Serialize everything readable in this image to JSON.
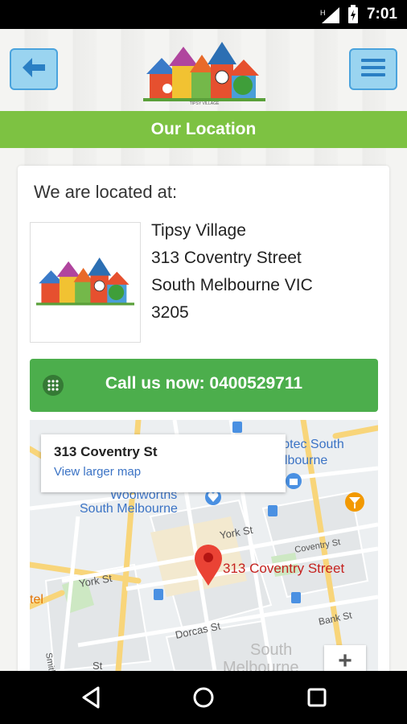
{
  "status_bar": {
    "time": "7:01"
  },
  "header": {
    "back_icon": "arrow-left-icon",
    "menu_icon": "hamburger-menu-icon",
    "logo_icon": "tipsy-village-logo"
  },
  "title_bar": {
    "title": "Our Location"
  },
  "location": {
    "intro": "We are located at:",
    "address_lines": [
      "Tipsy Village",
      "313 Coventry Street",
      "South Melbourne VIC",
      "3205"
    ]
  },
  "call_button": {
    "label": "Call us now: 0400529711",
    "icon": "phone-dialpad-icon"
  },
  "map": {
    "info_title": "313 Coventry St",
    "info_link": "View larger map",
    "pin_label": "313 Coventry Street",
    "places": {
      "woolworths": "Woolworths",
      "south_melbourne": "South Melbourne",
      "corptec": "orptec South",
      "corptec2": "elbourne",
      "york_st_1": "York St",
      "york_st_2": "York St",
      "coventry_st": "Coventry St",
      "dorcas_st": "Dorcas St",
      "bank_st": "Bank St",
      "smith_st": "Smith St",
      "tel": "tel",
      "south_bottom": "South",
      "melbourne_bottom": "Melbourne",
      "st_bottom": "St"
    },
    "zoom_label": "+",
    "colors": {
      "pin": "#ea4335",
      "pin_text": "#c5221f",
      "road_major": "#f8d57a",
      "link": "#3b73c5"
    }
  },
  "nav_bar": {
    "back_icon": "nav-back-icon",
    "home_icon": "nav-home-icon",
    "recents_icon": "nav-recents-icon"
  },
  "colors": {
    "accent_green": "#7dc242",
    "call_green": "#4cae4c",
    "header_btn": "#9ad4f0"
  }
}
